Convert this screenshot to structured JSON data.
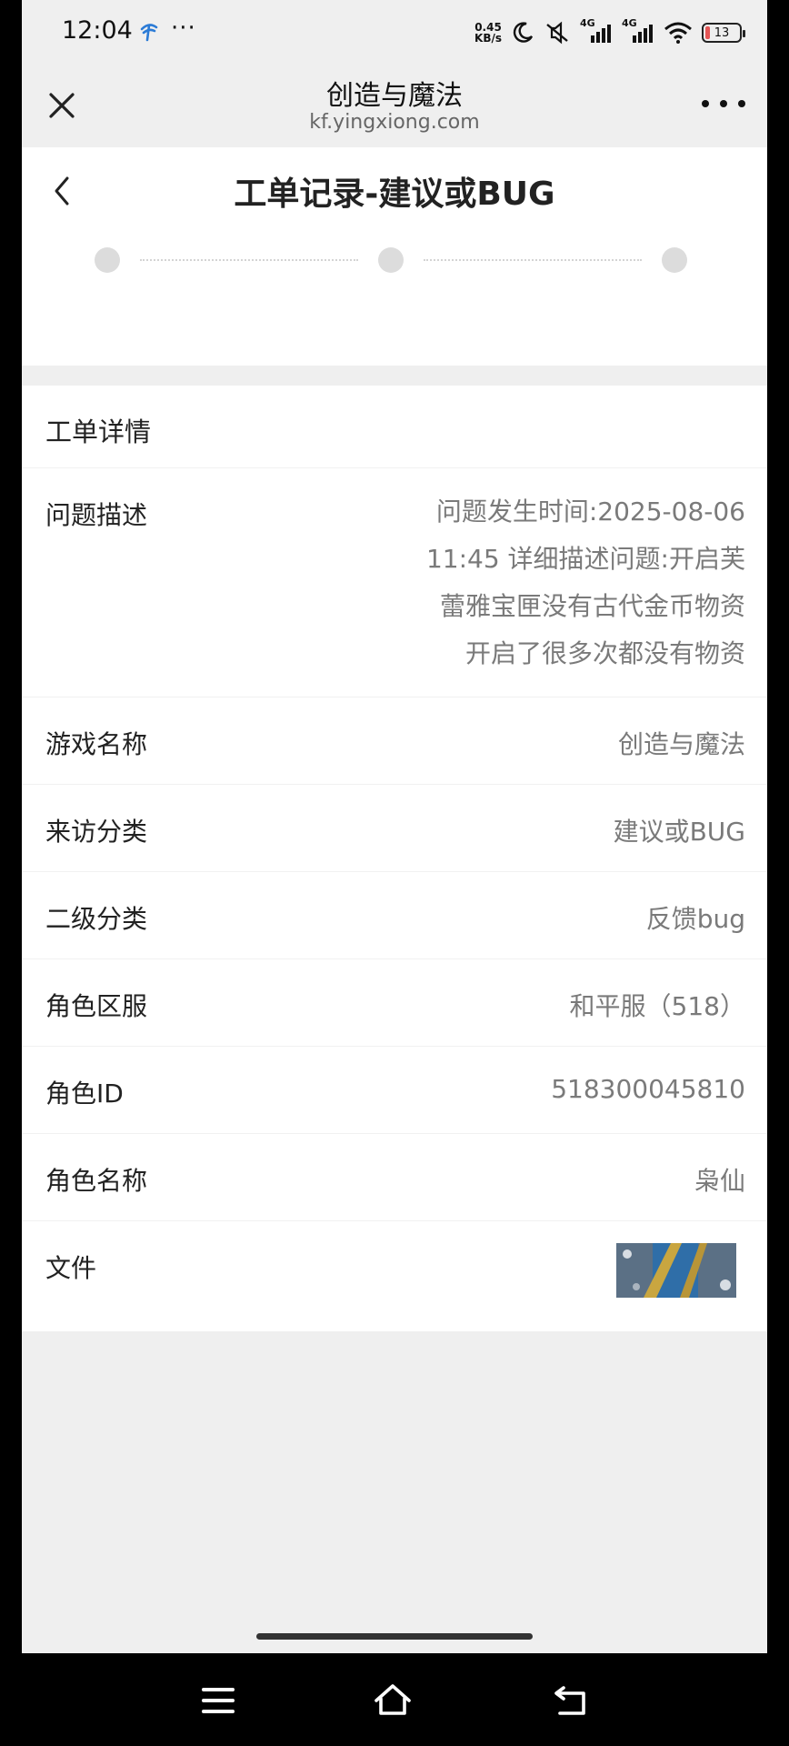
{
  "status_bar": {
    "time": "12:04",
    "dots": "···",
    "speed_value": "0.45",
    "speed_unit": "KB/s",
    "network_1": "4G",
    "network_2": "4G",
    "battery": "13",
    "battery_level": 0.13,
    "battery_color": "#e23b3b"
  },
  "browser": {
    "title": "创造与魔法",
    "url": "kf.yingxiong.com"
  },
  "page": {
    "title": "工单记录-建议或BUG"
  },
  "details": {
    "section_title": "工单详情",
    "description_label": "问题描述",
    "description_lines": [
      "问题发生时间:2025-08-06",
      "11:45 详细描述问题:开启芙",
      "蕾雅宝匣没有古代金币物资",
      "开启了很多次都没有物资"
    ],
    "rows": [
      {
        "label": "游戏名称",
        "value": "创造与魔法"
      },
      {
        "label": "来访分类",
        "value": "建议或BUG"
      },
      {
        "label": "二级分类",
        "value": "反馈bug"
      },
      {
        "label": "角色区服",
        "value": "和平服（518）"
      },
      {
        "label": "角色ID",
        "value": "518300045810"
      },
      {
        "label": "角色名称",
        "value": "枭仙"
      }
    ],
    "file_label": "文件"
  },
  "icons": {
    "close": "close-icon",
    "more": "more-icon",
    "back": "back-arrow-icon",
    "nav_menu": "menu-icon",
    "nav_home": "home-icon",
    "nav_back": "back-icon"
  }
}
